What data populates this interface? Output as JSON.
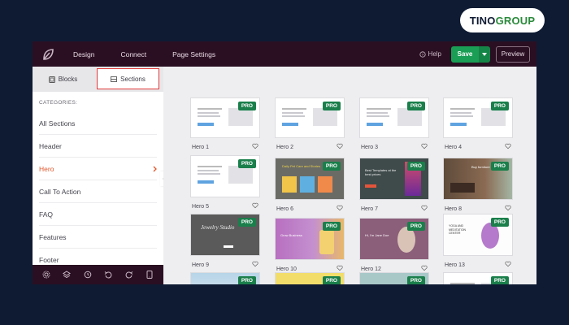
{
  "watermark": {
    "brand_main": "TINO",
    "brand_accent": "GROUP"
  },
  "topbar": {
    "nav": [
      "Design",
      "Connect",
      "Page Settings"
    ],
    "help_label": "Help",
    "save_label": "Save",
    "preview_label": "Preview"
  },
  "sidebar": {
    "tabs": [
      {
        "label": "Blocks",
        "icon": "blocks-icon",
        "active": false
      },
      {
        "label": "Sections",
        "icon": "sections-icon",
        "active": true
      }
    ],
    "categories_title": "CATEGORIES:",
    "categories": [
      {
        "label": "All Sections",
        "active": false
      },
      {
        "label": "Header",
        "active": false
      },
      {
        "label": "Hero",
        "active": true
      },
      {
        "label": "Call To Action",
        "active": false
      },
      {
        "label": "FAQ",
        "active": false
      },
      {
        "label": "Features",
        "active": false
      },
      {
        "label": "Footer",
        "active": false
      }
    ],
    "bottom_tools": [
      "settings-icon",
      "layers-icon",
      "history-icon",
      "undo-icon",
      "redo-icon",
      "mobile-icon"
    ]
  },
  "gallery": {
    "badge_label": "PRO",
    "cards": [
      {
        "name": "Hero 1",
        "style": "wire"
      },
      {
        "name": "Hero 2",
        "style": "wire"
      },
      {
        "name": "Hero 3",
        "style": "wire"
      },
      {
        "name": "Hero 4",
        "style": "wire"
      },
      {
        "name": "Hero 5",
        "style": "wire"
      },
      {
        "name": "Hero 6",
        "style": "pet",
        "thumb_text": "Daily Pet Care and Stories"
      },
      {
        "name": "Hero 7",
        "style": "dark",
        "thumb_text": "Best Templates at the best prices"
      },
      {
        "name": "Hero 8",
        "style": "room",
        "thumb_text": "Buy furniture"
      },
      {
        "name": "Hero 9",
        "style": "jewelry",
        "thumb_text": "Jewelry Studio"
      },
      {
        "name": "Hero 10",
        "style": "gradient",
        "thumb_text": "Grow Business"
      },
      {
        "name": "Hero 12",
        "style": "portrait",
        "thumb_text": "Hi, I'm Jane Doe"
      },
      {
        "name": "Hero 13",
        "style": "fitness",
        "thumb_text": "YOGA AND MEDITATION CENTER"
      },
      {
        "name": "",
        "style": "blue"
      },
      {
        "name": "",
        "style": "yellow"
      },
      {
        "name": "",
        "style": "teal"
      },
      {
        "name": "",
        "style": "wire"
      }
    ]
  },
  "colors": {
    "page_bg": "#0f1b33",
    "topbar_bg": "#2a0f22",
    "save_green": "#1a9e55",
    "pro_badge": "#1a7f4b",
    "active_category": "#e2572c",
    "highlight_border": "#e23b3b"
  }
}
